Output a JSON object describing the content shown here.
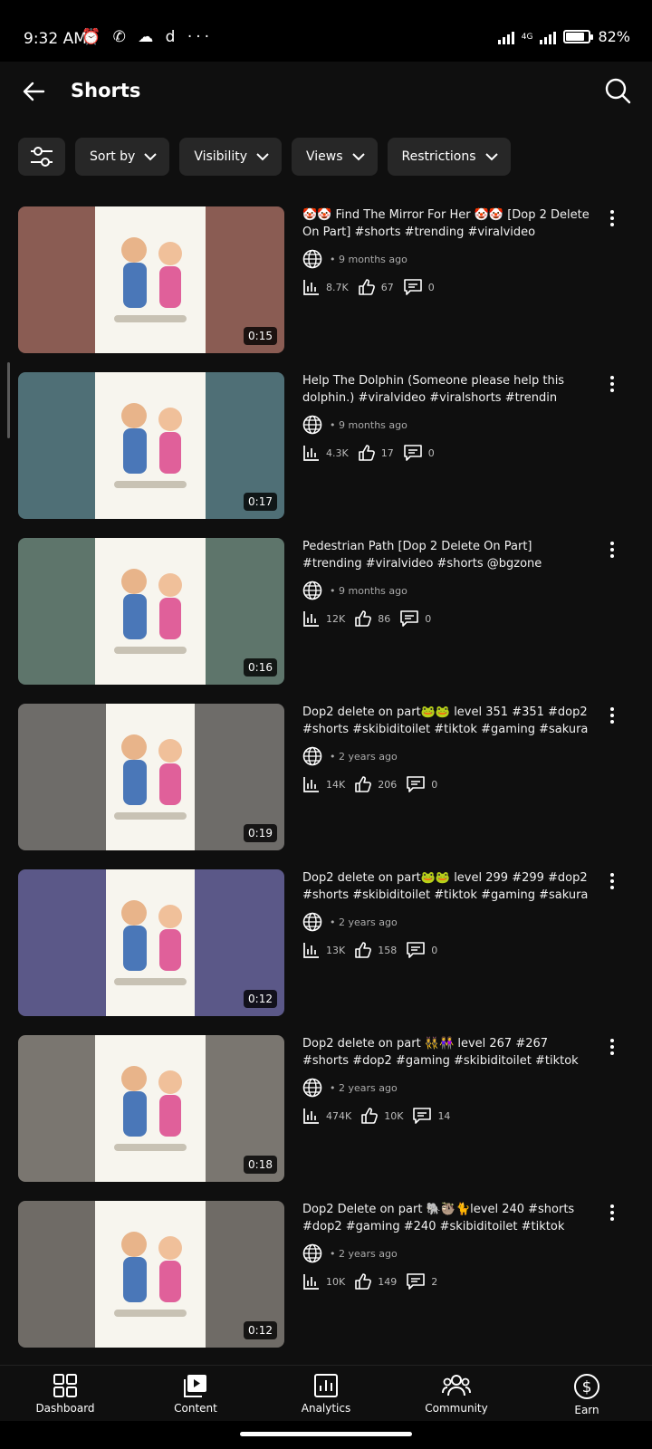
{
  "status": {
    "time": "9:32 AM",
    "battery": "82%",
    "battery_level": 0.82,
    "network": "4G"
  },
  "header": {
    "title": "Shorts"
  },
  "filters": [
    {
      "label": "Sort by"
    },
    {
      "label": "Visibility"
    },
    {
      "label": "Views"
    },
    {
      "label": "Restrictions"
    }
  ],
  "videos": [
    {
      "title": "🤡🤡 Find The Mirror For Her 🤡🤡 [Dop 2 Delete On Part] #shorts #trending #viralvideo @bgzone",
      "visibility_icon": "globe-icon",
      "age": "• 9 months ago",
      "views": "8.7K",
      "likes": "67",
      "comments": "0",
      "duration": "0:15",
      "bg": "#8a5c53"
    },
    {
      "title": "Help The Dolphin (Someone please help this dolphin.) #viralvideo #viralshorts #trendin @BGzone",
      "visibility_icon": "globe-icon",
      "age": "• 9 months ago",
      "views": "4.3K",
      "likes": "17",
      "comments": "0",
      "duration": "0:17",
      "bg": "#4f6f76"
    },
    {
      "title": "Pedestrian Path [Dop 2 Delete On Part] #trending #viralvideo #shorts @bgzone",
      "visibility_icon": "globe-icon",
      "age": "• 9 months ago",
      "views": "12K",
      "likes": "86",
      "comments": "0",
      "duration": "0:16",
      "bg": "#5e756b"
    },
    {
      "title": "Dop2 delete on part🐸🐸 level 351 #351 #dop2 #shorts #skibiditoilet #tiktok  #gaming #sakura",
      "visibility_icon": "globe-icon",
      "age": "• 2 years ago",
      "views": "14K",
      "likes": "206",
      "comments": "0",
      "duration": "0:19",
      "bg": "#6e6c69"
    },
    {
      "title": "Dop2 delete on part🐸🐸 level 299 #299 #dop2 #shorts #skibiditoilet #tiktok  #gaming #sakura",
      "visibility_icon": "globe-icon",
      "age": "• 2 years ago",
      "views": "13K",
      "likes": "158",
      "comments": "0",
      "duration": "0:12",
      "bg": "#5b5888"
    },
    {
      "title": "Dop2 delete on part 👯‍♀️👭 level 267 #267 #shorts #dop2 #gaming #skibiditoilet #tiktok #sakura",
      "visibility_icon": "globe-icon",
      "age": "• 2 years ago",
      "views": "474K",
      "likes": "10K",
      "comments": "14",
      "duration": "0:18",
      "bg": "#7a7670"
    },
    {
      "title": "Dop2 Delete on part 🐘🦥🐈level 240 #shorts #dop2 #gaming #240 #skibiditoilet #tiktok",
      "visibility_icon": "globe-icon",
      "age": "• 2 years ago",
      "views": "10K",
      "likes": "149",
      "comments": "2",
      "duration": "0:12",
      "bg": "#6f6b66"
    }
  ],
  "nav": [
    {
      "label": "Dashboard",
      "icon": "dashboard-icon"
    },
    {
      "label": "Content",
      "icon": "content-icon"
    },
    {
      "label": "Analytics",
      "icon": "analytics-icon"
    },
    {
      "label": "Community",
      "icon": "community-icon"
    },
    {
      "label": "Earn",
      "icon": "earn-icon"
    }
  ]
}
